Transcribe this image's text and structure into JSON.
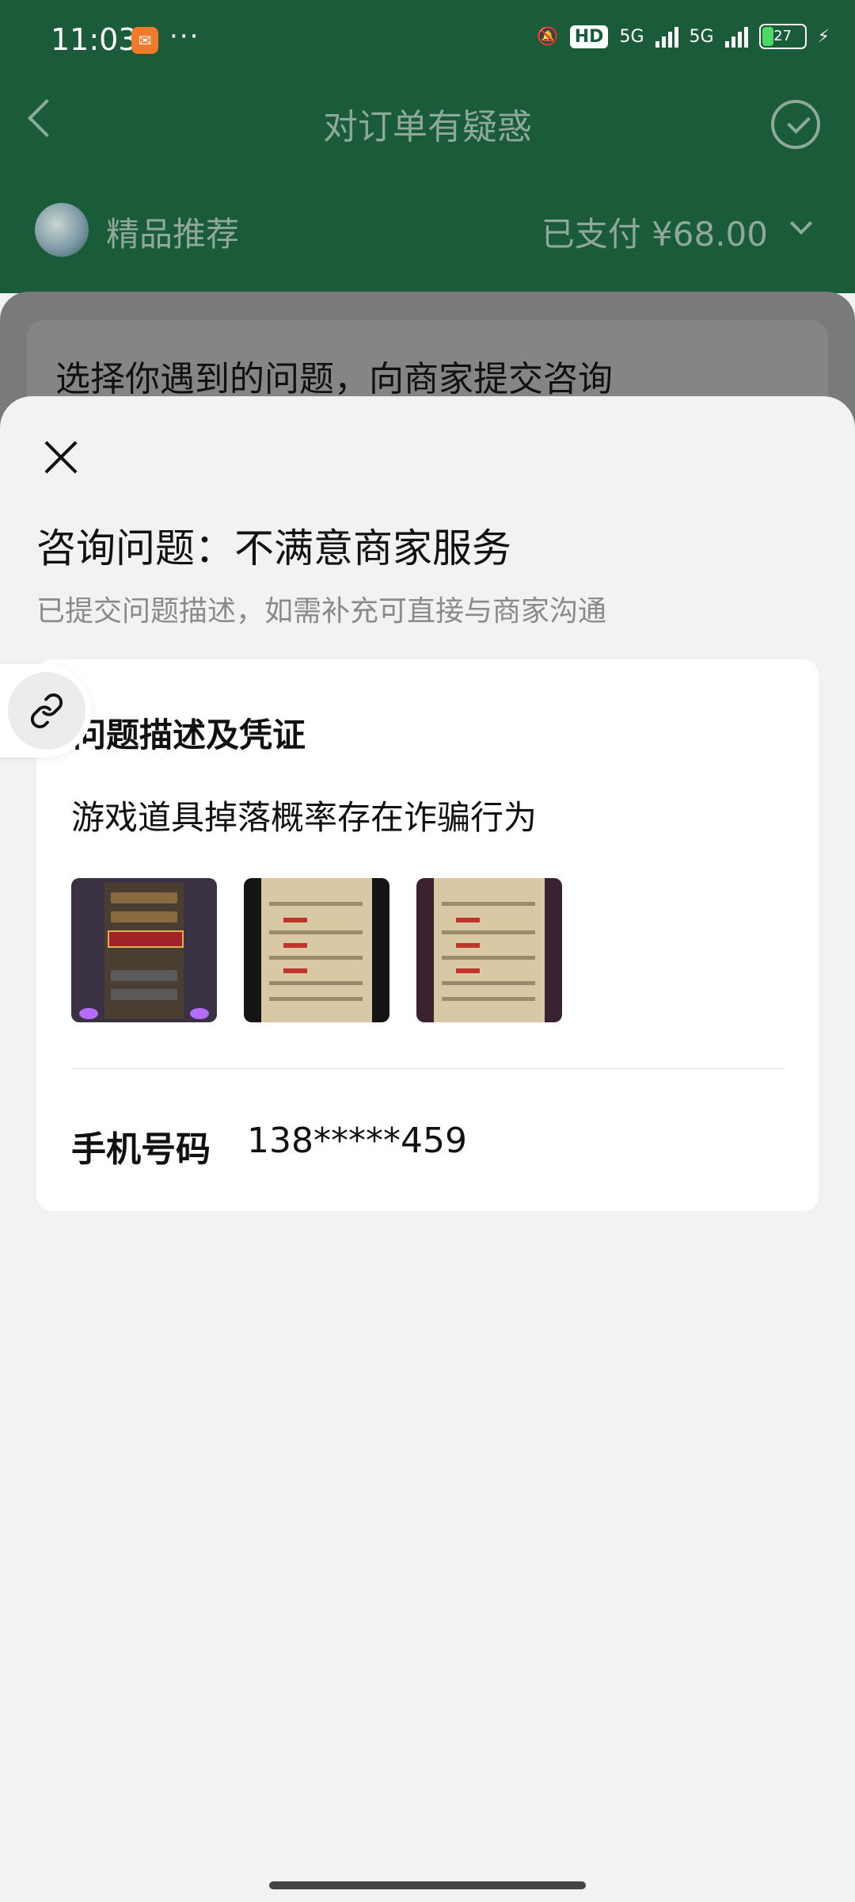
{
  "status_bar": {
    "time": "11:03",
    "dots": "···",
    "hd": "HD",
    "net1": "5G",
    "net2": "5G",
    "battery": "27"
  },
  "nav": {
    "title": "对订单有疑惑"
  },
  "shop": {
    "name": "精品推荐",
    "paid": "已支付 ¥68.00"
  },
  "background_card": {
    "text": "选择你遇到的问题，向商家提交咨询"
  },
  "sheet": {
    "title": "咨询问题：不满意商家服务",
    "subtitle": "已提交问题描述，如需补充可直接与商家沟通",
    "section_title": "问题描述及凭证",
    "description": "游戏道具掉落概率存在诈骗行为",
    "phone_label": "手机号码",
    "phone_value": "138*****459"
  },
  "colors": {
    "header_green": "#1a5b3a",
    "sheet_bg": "#f2f2f2"
  },
  "icons": [
    "back-arrow-icon",
    "chat-check-icon",
    "close-icon",
    "link-icon",
    "chevron-down-icon"
  ]
}
